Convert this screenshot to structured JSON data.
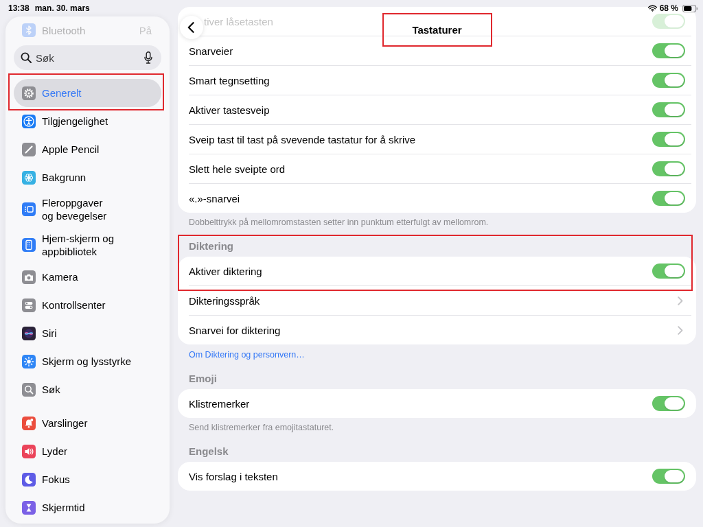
{
  "status_bar": {
    "time": "13:38",
    "date": "man. 30. mars",
    "battery": "68 %"
  },
  "sidebar": {
    "faded_item": {
      "label": "Bluetooth",
      "value": "På"
    },
    "search": {
      "placeholder": "Søk"
    },
    "groups": [
      [
        {
          "label": "Generelt",
          "selected": true,
          "highlighted": true,
          "color": "#8e8e93"
        },
        {
          "label": "Tilgjengelighet",
          "selected": false,
          "highlighted": false,
          "color": "#1a7cf5"
        },
        {
          "label": "Apple Pencil",
          "selected": false,
          "highlighted": false,
          "color": "#8e8e93"
        },
        {
          "label": "Bakgrunn",
          "selected": false,
          "highlighted": false,
          "color": "#36b1e3"
        },
        {
          "label": "Fleroppgaver\nog bevegelser",
          "selected": false,
          "highlighted": false,
          "color": "#2f7cf6"
        },
        {
          "label": "Hjem-skjerm og\nappbibliotek",
          "selected": false,
          "highlighted": false,
          "color": "#2f7cf6"
        },
        {
          "label": "Kamera",
          "selected": false,
          "highlighted": false,
          "color": "#8e8e93"
        },
        {
          "label": "Kontrollsenter",
          "selected": false,
          "highlighted": false,
          "color": "#8e8e93"
        },
        {
          "label": "Siri",
          "selected": false,
          "highlighted": false,
          "color": "#2a2238"
        },
        {
          "label": "Skjerm og lysstyrke",
          "selected": false,
          "highlighted": false,
          "color": "#2f86f6"
        },
        {
          "label": "Søk",
          "selected": false,
          "highlighted": false,
          "color": "#8e8e93"
        }
      ],
      [
        {
          "label": "Varslinger",
          "selected": false,
          "highlighted": false,
          "color": "#eb4d3d"
        },
        {
          "label": "Lyder",
          "selected": false,
          "highlighted": false,
          "color": "#eb445a"
        },
        {
          "label": "Fokus",
          "selected": false,
          "highlighted": false,
          "color": "#5e5ce6"
        },
        {
          "label": "Skjermtid",
          "selected": false,
          "highlighted": false,
          "color": "#7b61e6"
        }
      ]
    ]
  },
  "header": {
    "title": "Tastaturer",
    "highlighted": true
  },
  "sections": [
    {
      "highlighted": false,
      "faded_row": {
        "label": "tiver låsetasten",
        "on": true
      },
      "rows": [
        {
          "kind": "toggle",
          "label": "Snarveier",
          "on": true
        },
        {
          "kind": "toggle",
          "label": "Smart tegnsetting",
          "on": true
        },
        {
          "kind": "toggle",
          "label": "Aktiver tastesveip",
          "on": true
        },
        {
          "kind": "toggle",
          "label": "Sveip tast til tast på svevende tastatur for å skrive",
          "on": true
        },
        {
          "kind": "toggle",
          "label": "Slett hele sveipte ord",
          "on": true
        },
        {
          "kind": "toggle",
          "label": "«.»-snarvei",
          "on": true
        }
      ],
      "footer": "Dobbelttrykk på mellomromstasten setter inn punktum etterfulgt av mellomrom."
    },
    {
      "header": "Diktering",
      "highlighted": true,
      "rows": [
        {
          "kind": "toggle",
          "label": "Aktiver diktering",
          "on": true
        },
        {
          "kind": "link",
          "label": "Dikteringsspråk"
        },
        {
          "kind": "link",
          "label": "Snarvei for diktering"
        }
      ],
      "link": "Om Diktering og personvern…"
    },
    {
      "header": "Emoji",
      "highlighted": false,
      "rows": [
        {
          "kind": "toggle",
          "label": "Klistremerker",
          "on": true
        }
      ],
      "footer": "Send klistremerker fra emojitastaturet."
    },
    {
      "header": "Engelsk",
      "highlighted": false,
      "rows": [
        {
          "kind": "toggle",
          "label": "Vis forslag i teksten",
          "on": true
        }
      ]
    }
  ]
}
